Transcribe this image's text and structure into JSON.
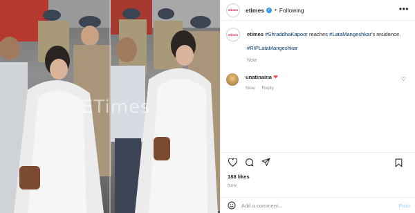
{
  "photo": {
    "watermark": "ETimes"
  },
  "header": {
    "avatar_text": "etimes",
    "username": "etimes",
    "verified_icon": "verified-badge-icon",
    "separator": "•",
    "follow_state": "Following",
    "more_icon": "more-options-icon"
  },
  "caption": {
    "username": "etimes",
    "tag1": "#ShraddhaKapoor",
    "text1": "reaches",
    "tag2": "#LataMangeshkar",
    "text2": "'s residence.",
    "tag3": "#RIPLataMangeshkar",
    "time": "Now"
  },
  "comment": {
    "username": "unatinaina",
    "heart_icon": "red-heart-icon",
    "time": "Now",
    "reply_label": "Reply"
  },
  "actions": {
    "like_icon": "heart-outline-icon",
    "comment_icon": "comment-icon",
    "share_icon": "share-icon",
    "save_icon": "bookmark-icon"
  },
  "likes": "188 likes",
  "post_time": "Now",
  "add_comment": {
    "placeholder": "Add a comment...",
    "post_label": "Post"
  },
  "colors": {
    "link": "#00376b",
    "verified": "#3897f0",
    "muted": "#8e8e8e",
    "post_button": "#b3dbff",
    "heart": "#ed4956"
  }
}
